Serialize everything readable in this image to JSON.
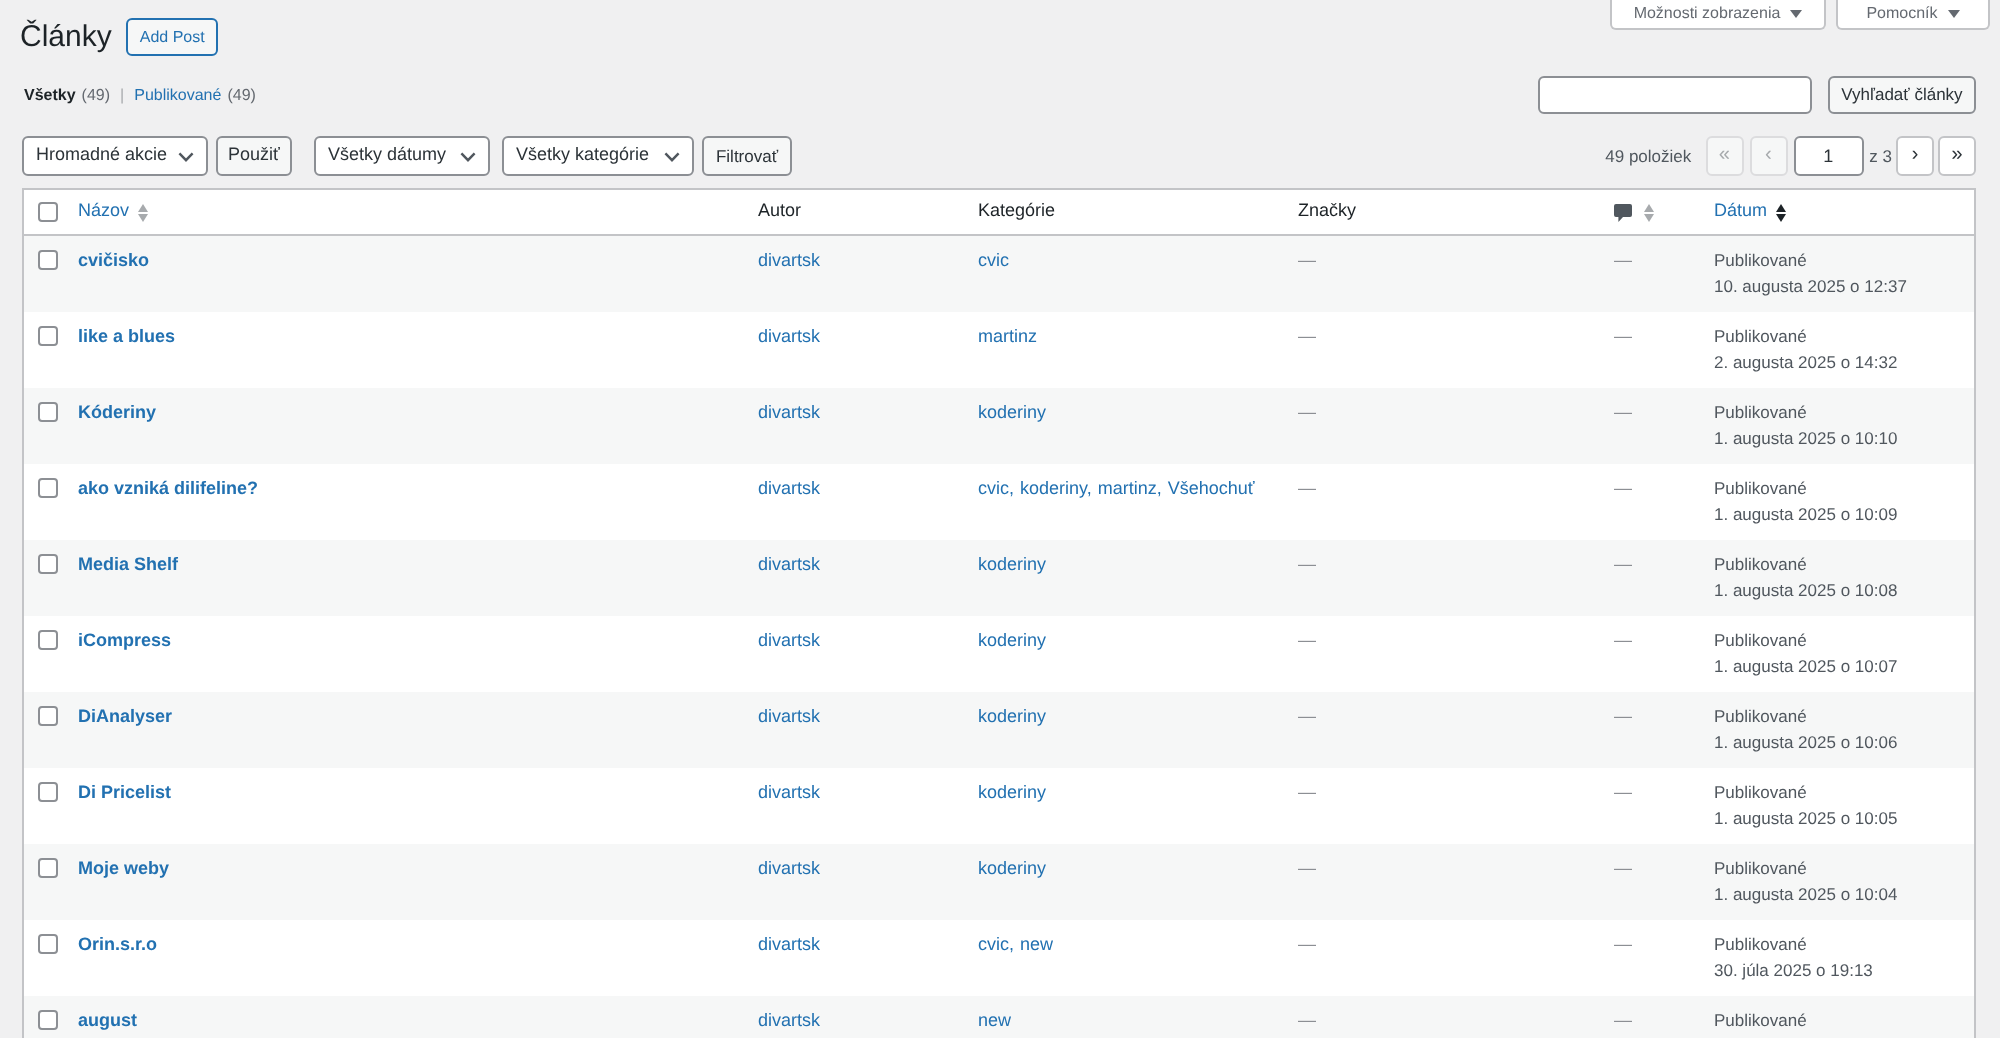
{
  "header": {
    "title": "Články",
    "add_button": "Add Post",
    "tabs": [
      {
        "label": "Možnosti zobrazenia"
      },
      {
        "label": "Pomocník"
      }
    ]
  },
  "views": {
    "items": [
      {
        "label": "Všetky",
        "count": "(49)",
        "selected": true
      },
      {
        "label": "Publikované",
        "count": "(49)",
        "selected": false
      }
    ],
    "separator": "|"
  },
  "search": {
    "button": "Vyhľadať články"
  },
  "filters": {
    "bulk_action": "Hromadné akcie",
    "apply_button": "Použiť",
    "date_filter": "Všetky dátumy",
    "category_filter": "Všetky kategórie",
    "filter_button": "Filtrovať"
  },
  "pagination": {
    "count": "49 položiek",
    "first": {
      "label": "«",
      "disabled": true
    },
    "prev": {
      "label": "‹",
      "disabled": true
    },
    "current_page": "1",
    "total_pages": "z 3",
    "next": {
      "label": "›",
      "disabled": false
    },
    "last": {
      "label": "»",
      "disabled": false
    }
  },
  "table": {
    "select_all": {
      "checked": false
    },
    "columns": [
      {
        "kind": "text",
        "label": "Názov",
        "sortable": true,
        "sorted": false
      },
      {
        "kind": "text",
        "label": "Autor",
        "sortable": false
      },
      {
        "kind": "text",
        "label": "Kategórie",
        "sortable": false
      },
      {
        "kind": "text",
        "label": "Značky",
        "sortable": false
      },
      {
        "kind": "icon",
        "sortable": true,
        "sorted": false
      },
      {
        "kind": "text",
        "label": "Dátum",
        "sortable": true,
        "sorted": true
      }
    ],
    "rows": [
      {
        "title": "cvičisko",
        "author": "divartsk",
        "categories": [
          "cvic"
        ],
        "tags": "—",
        "comments": "—",
        "status": "Publikované",
        "date": "10. augusta 2025 o 12:37",
        "checked": false
      },
      {
        "title": "like a blues",
        "author": "divartsk",
        "categories": [
          "martinz"
        ],
        "tags": "—",
        "comments": "—",
        "status": "Publikované",
        "date": "2. augusta 2025 o 14:32",
        "checked": false
      },
      {
        "title": "Kóderiny",
        "author": "divartsk",
        "categories": [
          "koderiny"
        ],
        "tags": "—",
        "comments": "—",
        "status": "Publikované",
        "date": "1. augusta 2025 o 10:10",
        "checked": false
      },
      {
        "title": "ako vzniká dilifeline?",
        "author": "divartsk",
        "categories": [
          "cvic,",
          "koderiny,",
          "martinz,",
          "Všehochuť"
        ],
        "tags": "—",
        "comments": "—",
        "status": "Publikované",
        "date": "1. augusta 2025 o 10:09",
        "checked": false
      },
      {
        "title": "Media Shelf",
        "author": "divartsk",
        "categories": [
          "koderiny"
        ],
        "tags": "—",
        "comments": "—",
        "status": "Publikované",
        "date": "1. augusta 2025 o 10:08",
        "checked": false
      },
      {
        "title": "iCompress",
        "author": "divartsk",
        "categories": [
          "koderiny"
        ],
        "tags": "—",
        "comments": "—",
        "status": "Publikované",
        "date": "1. augusta 2025 o 10:07",
        "checked": false
      },
      {
        "title": "DiAnalyser",
        "author": "divartsk",
        "categories": [
          "koderiny"
        ],
        "tags": "—",
        "comments": "—",
        "status": "Publikované",
        "date": "1. augusta 2025 o 10:06",
        "checked": false
      },
      {
        "title": "Di Pricelist",
        "author": "divartsk",
        "categories": [
          "koderiny"
        ],
        "tags": "—",
        "comments": "—",
        "status": "Publikované",
        "date": "1. augusta 2025 o 10:05",
        "checked": false
      },
      {
        "title": "Moje weby",
        "author": "divartsk",
        "categories": [
          "koderiny"
        ],
        "tags": "—",
        "comments": "—",
        "status": "Publikované",
        "date": "1. augusta 2025 o 10:04",
        "checked": false
      },
      {
        "title": "Orin.s.r.o",
        "author": "divartsk",
        "categories": [
          "cvic,",
          "new"
        ],
        "tags": "—",
        "comments": "—",
        "status": "Publikované",
        "date": "30. júla 2025 o 19:13",
        "checked": false
      },
      {
        "title": "august",
        "author": "divartsk",
        "categories": [
          "new"
        ],
        "tags": "—",
        "comments": "—",
        "status": "Publikované",
        "checked": false
      }
    ]
  }
}
